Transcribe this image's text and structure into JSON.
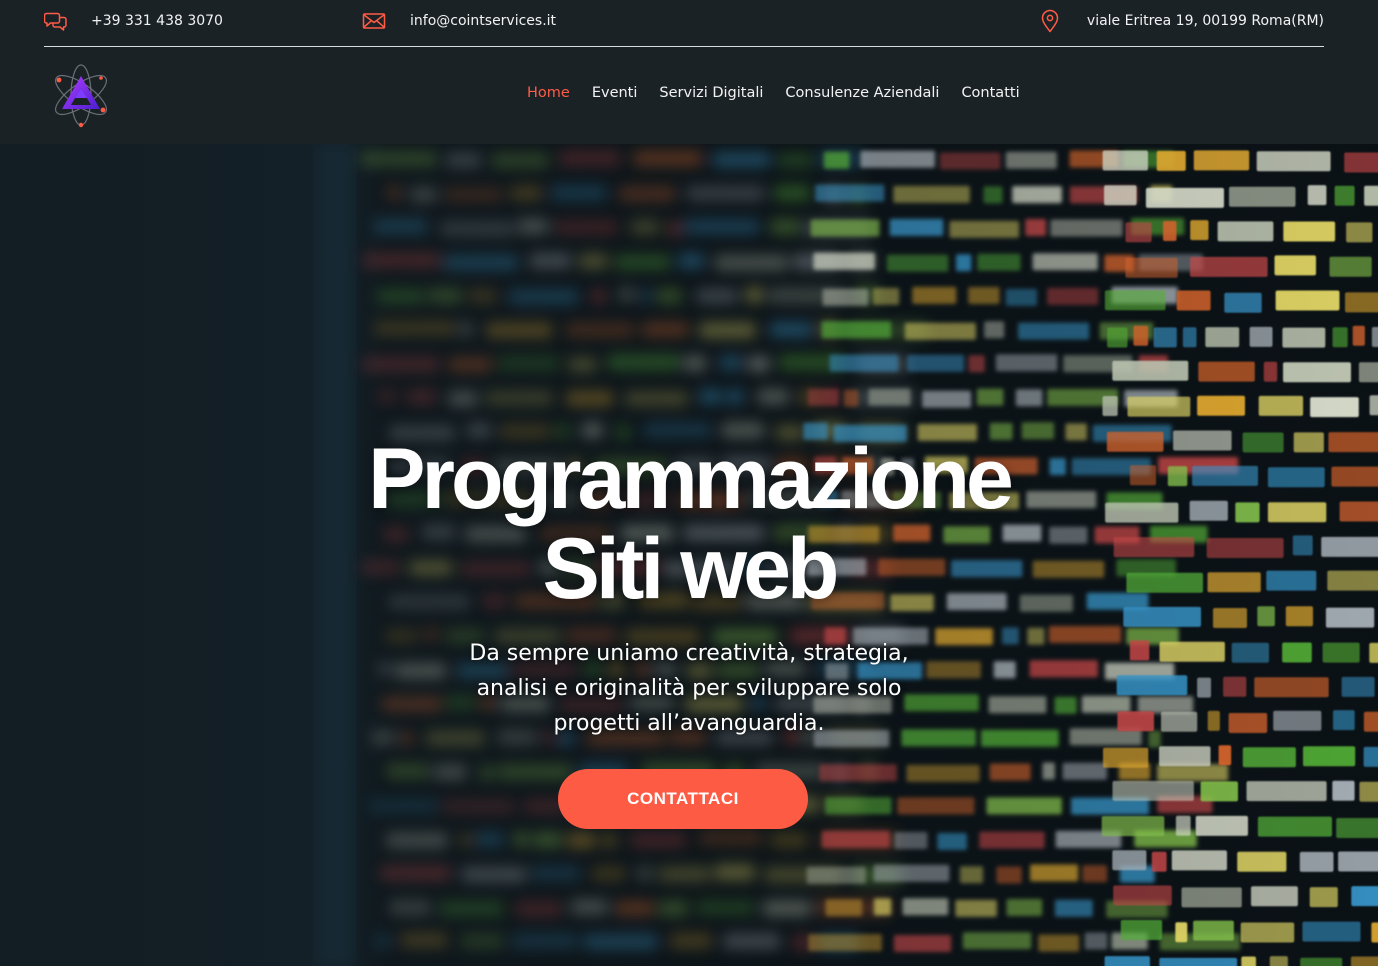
{
  "topbar": {
    "phone": "+39 331 438 3070",
    "email": "info@cointservices.it",
    "address": "viale Eritrea 19, 00199 Roma(RM)",
    "phone_icon": "chat-bubbles-icon",
    "email_icon": "envelope-icon",
    "address_icon": "map-pin-icon"
  },
  "nav": {
    "items": [
      {
        "label": "Home",
        "active": true
      },
      {
        "label": "Eventi",
        "active": false
      },
      {
        "label": "Servizi Digitali",
        "active": false
      },
      {
        "label": "Consulenze Aziendali",
        "active": false
      },
      {
        "label": "Contatti",
        "active": false
      }
    ]
  },
  "hero": {
    "title_line1": "Programmazione",
    "title_line2": "Siti web",
    "subtitle_line1": "Da sempre uniamo creatività, strategia,",
    "subtitle_line2": "analisi e originalità per sviluppare solo",
    "subtitle_line3": "progetti all’avanguardia.",
    "cta_label": "CONTATTACI",
    "background": "blurred-source-code-image"
  },
  "colors": {
    "accent": "#ff5b45",
    "header_bg": "#1b2226",
    "cta_bg": "#fd5b44",
    "text": "#ffffff"
  }
}
